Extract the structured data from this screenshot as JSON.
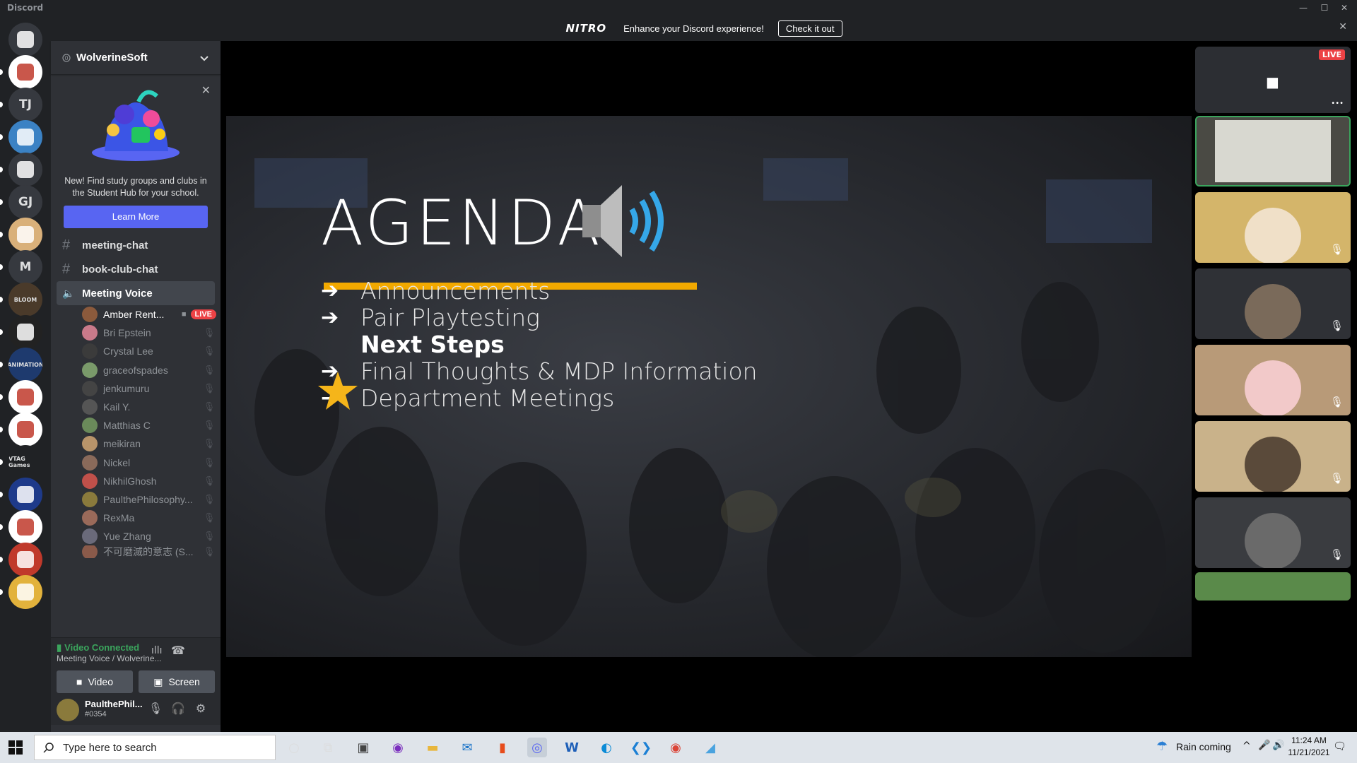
{
  "window": {
    "title": "Discord",
    "minimize": "—",
    "maximize": "☐",
    "close": "✕"
  },
  "nitro": {
    "logo": "NITRO",
    "text": "Enhance your Discord experience!",
    "button": "Check it out",
    "close": "✕"
  },
  "servers": [
    {
      "label": "",
      "icon": "discord-home-icon",
      "color": "#36393f"
    },
    {
      "label": "",
      "icon": "server-icon",
      "color": "#ffffff"
    },
    {
      "label": "TJ",
      "icon": "",
      "color": "#36393f"
    },
    {
      "label": "",
      "icon": "server-icon",
      "color": "#3b82c4"
    },
    {
      "label": "",
      "icon": "gamepad-icon",
      "color": "#36393f"
    },
    {
      "label": "GJ",
      "icon": "",
      "color": "#36393f"
    },
    {
      "label": "",
      "icon": "server-icon",
      "color": "#d9b07a"
    },
    {
      "label": "M",
      "icon": "",
      "color": "#36393f"
    },
    {
      "label": "BLOOM",
      "icon": "",
      "color": "#4a3a2a"
    },
    {
      "label": "",
      "icon": "server-icon",
      "color": "#222222"
    },
    {
      "label": "ANIMATION",
      "icon": "",
      "color": "#1e3a6e"
    },
    {
      "label": "",
      "icon": "server-icon",
      "color": "#ffffff"
    },
    {
      "label": "",
      "icon": "server-icon",
      "color": "#ffffff"
    },
    {
      "label": "VTAG Games",
      "icon": "",
      "color": "#202225"
    },
    {
      "label": "",
      "icon": "server-icon",
      "color": "#1e3a8a"
    },
    {
      "label": "",
      "icon": "server-icon",
      "color": "#ffffff"
    },
    {
      "label": "",
      "icon": "server-icon",
      "color": "#c0392b"
    },
    {
      "label": "",
      "icon": "server-icon",
      "color": "#e2b23c"
    }
  ],
  "sidebar": {
    "server_name": "WolverineSoft",
    "promo": {
      "text": "New! Find study groups and clubs in the Student Hub for your school.",
      "button": "Learn More",
      "close": "✕"
    },
    "channels": [
      {
        "name": "meeting-chat",
        "type": "text"
      },
      {
        "name": "book-club-chat",
        "type": "text"
      },
      {
        "name": "Meeting Voice",
        "type": "voice"
      }
    ],
    "voice_users": [
      {
        "name": "Amber Rent...",
        "live": "LIVE",
        "color": "#8b5a3c"
      },
      {
        "name": "Bri Epstein",
        "color": "#c97a8a"
      },
      {
        "name": "Crystal Lee",
        "color": "#3b3b3b"
      },
      {
        "name": "graceofspades",
        "color": "#7a9a6a"
      },
      {
        "name": "jenkumuru",
        "color": "#444444"
      },
      {
        "name": "Kail Y.",
        "color": "#555555"
      },
      {
        "name": "Matthias C",
        "color": "#6a8a5a"
      },
      {
        "name": "meikiran",
        "color": "#b8946a"
      },
      {
        "name": "Nickel",
        "color": "#8a6a5a"
      },
      {
        "name": "NikhilGhosh",
        "color": "#c0504a"
      },
      {
        "name": "PaulthePhilosophy...",
        "color": "#8a7a3c"
      },
      {
        "name": "RexMa",
        "color": "#9a6a5a"
      },
      {
        "name": "Yue Zhang",
        "color": "#6a6a7a"
      },
      {
        "name": "不可磨滅的意志 (S...",
        "color": "#8a5a4a"
      }
    ]
  },
  "voice_panel": {
    "status": "Video Connected",
    "subtitle": "Meeting Voice / Wolverine...",
    "video_button": "Video",
    "screen_button": "Screen"
  },
  "user": {
    "name": "PaulthePhil...",
    "tag": "#0354"
  },
  "slide": {
    "title": "AGENDA",
    "items": [
      {
        "text": "Announcements",
        "current": false
      },
      {
        "text": "Pair Playtesting",
        "current": false
      },
      {
        "text": "Next Steps",
        "current": true
      },
      {
        "text": "Final Thoughts & MDP Information",
        "current": false
      },
      {
        "text": "Department Meetings",
        "current": false
      }
    ],
    "arrow": "➔",
    "accent": "#f2a900"
  },
  "video_tiles": [
    {
      "name": "stream-preview",
      "live": "LIVE",
      "bg": "#2c2e33"
    },
    {
      "name": "classroom",
      "bg": "#4a4a44"
    },
    {
      "name": "avatar-girl",
      "bg": "#d4b56a"
    },
    {
      "name": "avatar-cat",
      "bg": "#2f3136"
    },
    {
      "name": "avatar-mask",
      "bg": "#b89a78"
    },
    {
      "name": "avatar-bird",
      "bg": "#c9b28a"
    },
    {
      "name": "avatar-cartoon",
      "bg": "#3a3c40"
    },
    {
      "name": "avatar-next",
      "bg": "#5a8a4a"
    }
  ],
  "taskbar": {
    "search_placeholder": "Type here to search",
    "weather": "Rain coming",
    "time": "11:24 AM",
    "date": "11/21/2021"
  }
}
